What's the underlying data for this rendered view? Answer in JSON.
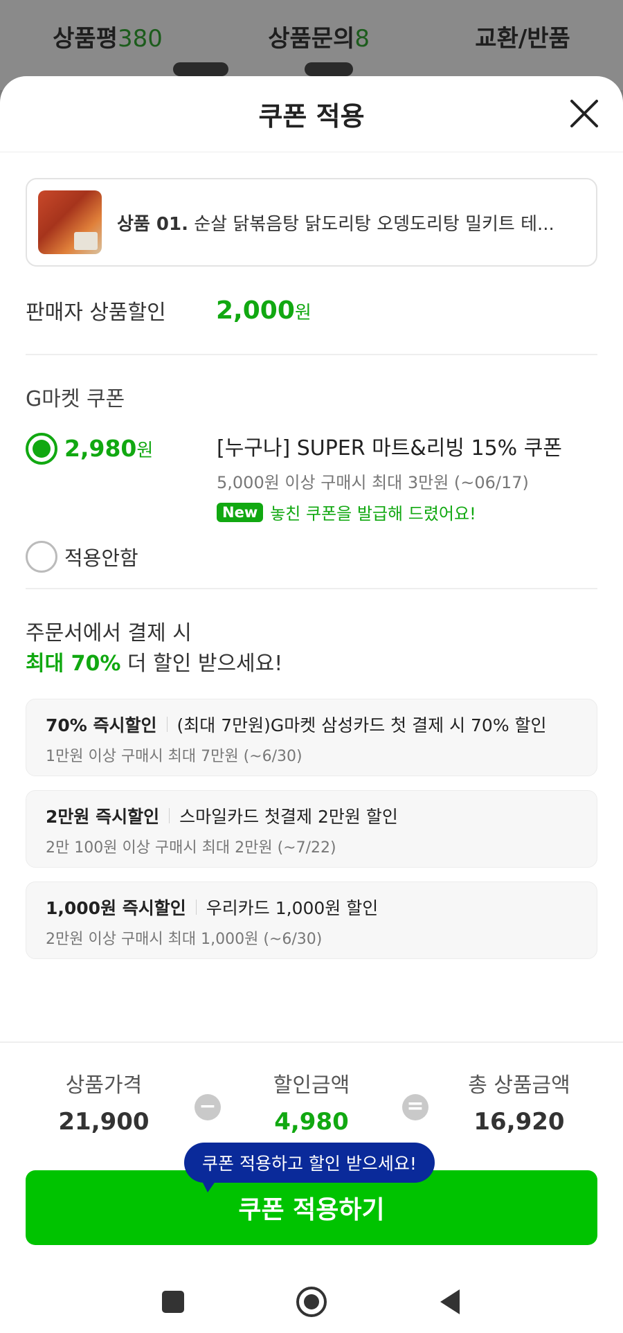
{
  "background_tabs": [
    {
      "label": "상품평",
      "count": "380"
    },
    {
      "label": "상품문의",
      "count": "8"
    },
    {
      "label": "교환/반품",
      "count": ""
    }
  ],
  "sheet": {
    "title": "쿠폰 적용"
  },
  "product": {
    "prefix": "상품 01.",
    "name": "순살 닭볶음탕 닭도리탕 오뎅도리탕 밀키트 테..."
  },
  "seller_discount": {
    "label": "판매자 상품할인",
    "amount": "2,000",
    "unit": "원"
  },
  "gmarket_coupon": {
    "title": "G마켓 쿠폰",
    "selected": {
      "amount": "2,980",
      "unit": "원",
      "name": "[누구나] SUPER 마트&리빙 15% 쿠폰",
      "condition": "5,000원 이상 구매시 최대 3만원 (~06/17)",
      "badge": "New",
      "notice": "놓친 쿠폰을 발급해 드렸어요!"
    },
    "none_label": "적용안함"
  },
  "promo": {
    "line1": "주문서에서 결제 시",
    "highlight": "최대 70%",
    "line2_rest": " 더 할인 받으세요!",
    "cards": [
      {
        "title": "70% 즉시할인",
        "desc": "(최대 7만원)G마켓 삼성카드 첫 결제 시 70% 할인",
        "cond": "1만원 이상 구매시 최대 7만원 (~6/30)"
      },
      {
        "title": "2만원 즉시할인",
        "desc": "스마일카드 첫결제 2만원 할인",
        "cond": "2만 100원 이상 구매시 최대 2만원 (~7/22)"
      },
      {
        "title": "1,000원 즉시할인",
        "desc": "우리카드 1,000원 할인",
        "cond": "2만원 이상 구매시 최대 1,000원 (~6/30)"
      }
    ]
  },
  "summary": {
    "price_label": "상품가격",
    "price": "21,900",
    "minus": "−",
    "discount_label": "할인금액",
    "discount": "4,980",
    "equals": "=",
    "total_label": "총 상품금액",
    "total": "16,920"
  },
  "tooltip": "쿠폰 적용하고 할인 받으세요!",
  "apply_button": "쿠폰 적용하기",
  "colors": {
    "accent": "#11a811",
    "button": "#00c300",
    "tooltip": "#0a2a9a"
  }
}
